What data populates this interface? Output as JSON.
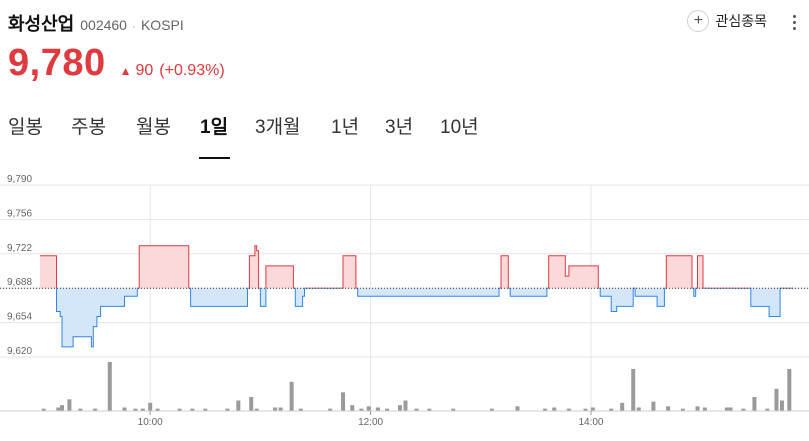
{
  "stock": {
    "name": "화성산업",
    "code": "002460",
    "separator": "·",
    "market": "KOSPI"
  },
  "watch": {
    "label": "관심종목",
    "icon": "plus-circle-icon"
  },
  "menu": {
    "icon": "more-vertical-icon"
  },
  "price": {
    "current": "9,780",
    "change_arrow": "▲",
    "change": "90",
    "change_pct": "(+0.93%)",
    "color_up": "#e0393e",
    "color_down": "#2f86e6"
  },
  "tabs": [
    "일봉",
    "주봉",
    "월봉",
    "1일",
    "3개월",
    "1년",
    "3년",
    "10년"
  ],
  "active_tab": "1일",
  "chart_data": {
    "type": "area",
    "baseline": 9688,
    "ylim": [
      9620,
      9790
    ],
    "yticks": [
      "9,790",
      "9,756",
      "9,722",
      "9,688",
      "9,654",
      "9,620"
    ],
    "ytick_values": [
      9790,
      9756,
      9722,
      9688,
      9654,
      9620
    ],
    "xticks": [
      {
        "label": "10:00",
        "t": 60
      },
      {
        "label": "12:00",
        "t": 180
      },
      {
        "label": "14:00",
        "t": 300
      }
    ],
    "xlim": [
      0,
      410
    ],
    "time_unit": "minutes since 09:00",
    "grid": true,
    "price_series": [
      [
        0,
        9720
      ],
      [
        7,
        9720
      ],
      [
        9,
        9665
      ],
      [
        11,
        9660
      ],
      [
        12,
        9630
      ],
      [
        16,
        9630
      ],
      [
        18,
        9640
      ],
      [
        27,
        9640
      ],
      [
        28,
        9630
      ],
      [
        29,
        9650
      ],
      [
        31,
        9660
      ],
      [
        33,
        9670
      ],
      [
        45,
        9670
      ],
      [
        46,
        9680
      ],
      [
        52,
        9680
      ],
      [
        53,
        9688
      ],
      [
        54,
        9730
      ],
      [
        60,
        9730
      ],
      [
        80,
        9730
      ],
      [
        81,
        9688
      ],
      [
        82,
        9670
      ],
      [
        112,
        9670
      ],
      [
        113,
        9688
      ],
      [
        114,
        9720
      ],
      [
        116,
        9720
      ],
      [
        117,
        9730
      ],
      [
        118,
        9725
      ],
      [
        119,
        9688
      ],
      [
        120,
        9670
      ],
      [
        122,
        9670
      ],
      [
        123,
        9710
      ],
      [
        137,
        9710
      ],
      [
        138,
        9688
      ],
      [
        139,
        9670
      ],
      [
        142,
        9670
      ],
      [
        143,
        9680
      ],
      [
        144,
        9688
      ],
      [
        164,
        9688
      ],
      [
        165,
        9720
      ],
      [
        171,
        9720
      ],
      [
        172,
        9688
      ],
      [
        173,
        9680
      ],
      [
        210,
        9680
      ],
      [
        249,
        9680
      ],
      [
        250,
        9688
      ],
      [
        251,
        9720
      ],
      [
        254,
        9720
      ],
      [
        255,
        9688
      ],
      [
        256,
        9680
      ],
      [
        275,
        9680
      ],
      [
        276,
        9688
      ],
      [
        277,
        9720
      ],
      [
        285,
        9720
      ],
      [
        286,
        9700
      ],
      [
        288,
        9710
      ],
      [
        303,
        9710
      ],
      [
        304,
        9688
      ],
      [
        305,
        9680
      ],
      [
        310,
        9680
      ],
      [
        311,
        9665
      ],
      [
        313,
        9665
      ],
      [
        314,
        9670
      ],
      [
        322,
        9670
      ],
      [
        323,
        9688
      ],
      [
        324,
        9680
      ],
      [
        335,
        9680
      ],
      [
        336,
        9670
      ],
      [
        339,
        9670
      ],
      [
        340,
        9688
      ],
      [
        341,
        9720
      ],
      [
        354,
        9720
      ],
      [
        355,
        9688
      ],
      [
        356,
        9680
      ],
      [
        357,
        9688
      ],
      [
        358,
        9720
      ],
      [
        360,
        9720
      ],
      [
        361,
        9688
      ],
      [
        386,
        9688
      ],
      [
        387,
        9670
      ],
      [
        396,
        9670
      ],
      [
        397,
        9660
      ],
      [
        402,
        9660
      ],
      [
        403,
        9688
      ],
      [
        410,
        9688
      ]
    ],
    "volume_bars": [
      {
        "t": 2,
        "v": 2
      },
      {
        "t": 10,
        "v": 3
      },
      {
        "t": 12,
        "v": 5
      },
      {
        "t": 16,
        "v": 10
      },
      {
        "t": 22,
        "v": 2
      },
      {
        "t": 30,
        "v": 2
      },
      {
        "t": 38,
        "v": 42
      },
      {
        "t": 46,
        "v": 3
      },
      {
        "t": 52,
        "v": 2
      },
      {
        "t": 56,
        "v": 2
      },
      {
        "t": 60,
        "v": 7
      },
      {
        "t": 64,
        "v": 2
      },
      {
        "t": 76,
        "v": 2
      },
      {
        "t": 83,
        "v": 2
      },
      {
        "t": 90,
        "v": 2
      },
      {
        "t": 102,
        "v": 2
      },
      {
        "t": 108,
        "v": 9
      },
      {
        "t": 115,
        "v": 12
      },
      {
        "t": 118,
        "v": 2
      },
      {
        "t": 128,
        "v": 3
      },
      {
        "t": 131,
        "v": 3
      },
      {
        "t": 137,
        "v": 25
      },
      {
        "t": 142,
        "v": 2
      },
      {
        "t": 158,
        "v": 2
      },
      {
        "t": 165,
        "v": 16
      },
      {
        "t": 170,
        "v": 5
      },
      {
        "t": 175,
        "v": 2
      },
      {
        "t": 179,
        "v": 4
      },
      {
        "t": 184,
        "v": 3
      },
      {
        "t": 189,
        "v": 2
      },
      {
        "t": 196,
        "v": 5
      },
      {
        "t": 199,
        "v": 9
      },
      {
        "t": 205,
        "v": 2
      },
      {
        "t": 212,
        "v": 2
      },
      {
        "t": 225,
        "v": 2
      },
      {
        "t": 246,
        "v": 2
      },
      {
        "t": 260,
        "v": 4
      },
      {
        "t": 275,
        "v": 2
      },
      {
        "t": 280,
        "v": 3
      },
      {
        "t": 288,
        "v": 2
      },
      {
        "t": 297,
        "v": 2
      },
      {
        "t": 301,
        "v": 3
      },
      {
        "t": 311,
        "v": 2
      },
      {
        "t": 317,
        "v": 7
      },
      {
        "t": 323,
        "v": 36
      },
      {
        "t": 326,
        "v": 3
      },
      {
        "t": 334,
        "v": 8
      },
      {
        "t": 342,
        "v": 4
      },
      {
        "t": 350,
        "v": 2
      },
      {
        "t": 358,
        "v": 4
      },
      {
        "t": 362,
        "v": 3
      },
      {
        "t": 374,
        "v": 3
      },
      {
        "t": 376,
        "v": 3
      },
      {
        "t": 383,
        "v": 2
      },
      {
        "t": 389,
        "v": 12
      },
      {
        "t": 396,
        "v": 2
      },
      {
        "t": 401,
        "v": 19
      },
      {
        "t": 404,
        "v": 9
      },
      {
        "t": 408,
        "v": 36
      }
    ]
  }
}
